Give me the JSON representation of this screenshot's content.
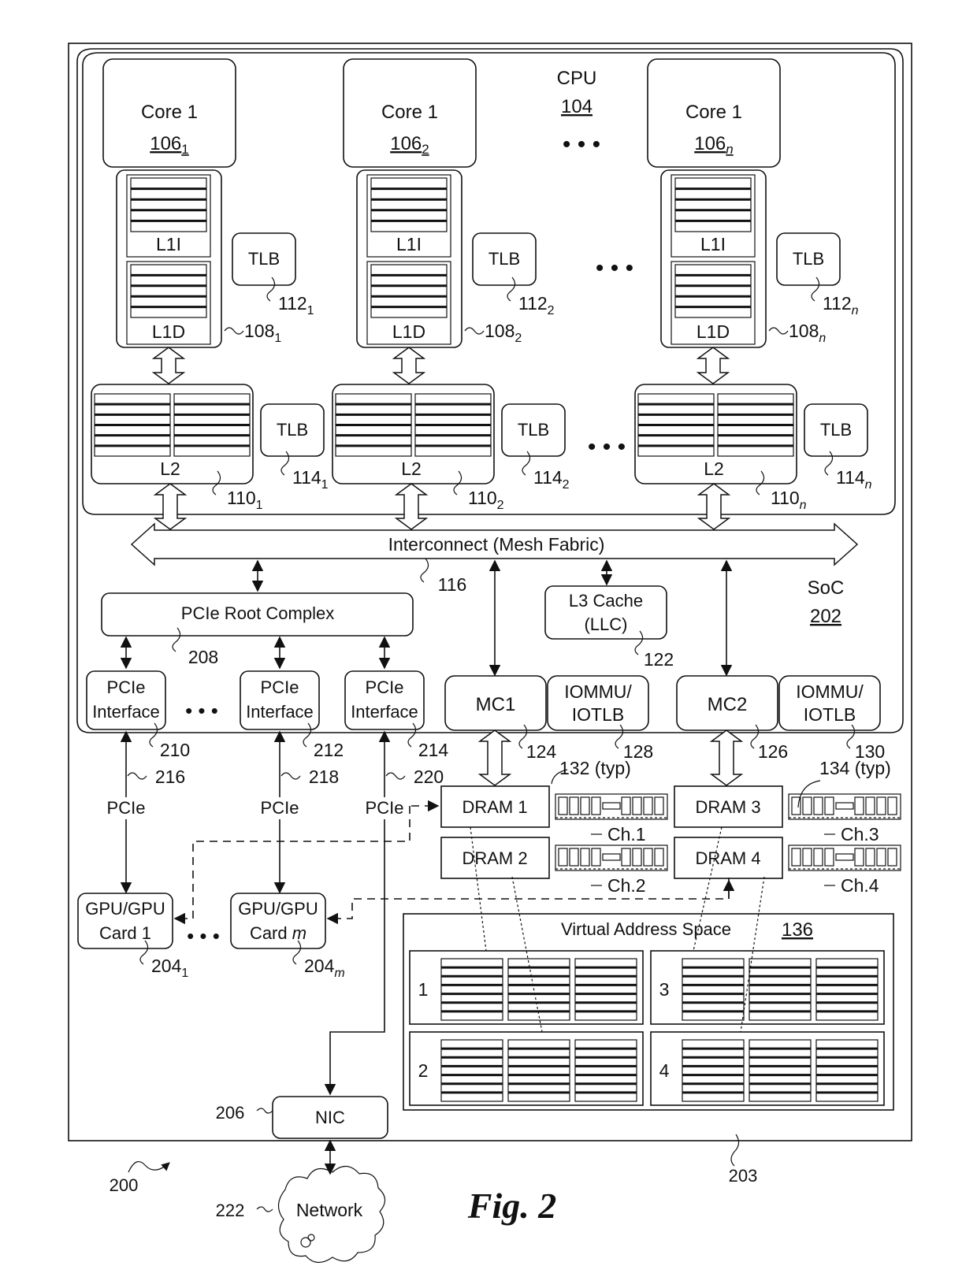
{
  "figure": {
    "caption": "Fig. 2",
    "system_ref": "200",
    "board_ref": "203"
  },
  "cpu": {
    "label": "CPU",
    "ref": "104",
    "ellipsis": "• • •"
  },
  "soc": {
    "label": "SoC",
    "ref": "202"
  },
  "cores": [
    {
      "label": "Core 1",
      "ref": "106",
      "sub": "1",
      "l1i": "L1I",
      "l1d": "L1D",
      "l1_ref": "108",
      "l1_sub": "1",
      "tlb1": "TLB",
      "tlb1_ref": "112",
      "tlb1_sub": "1",
      "l2": "L2",
      "l2_ref": "110",
      "l2_sub": "1",
      "tlb2": "TLB",
      "tlb2_ref": "114",
      "tlb2_sub": "1"
    },
    {
      "label": "Core 1",
      "ref": "106",
      "sub": "2",
      "l1i": "L1I",
      "l1d": "L1D",
      "l1_ref": "108",
      "l1_sub": "2",
      "tlb1": "TLB",
      "tlb1_ref": "112",
      "tlb1_sub": "2",
      "l2": "L2",
      "l2_ref": "110",
      "l2_sub": "2",
      "tlb2": "TLB",
      "tlb2_ref": "114",
      "tlb2_sub": "2"
    },
    {
      "label": "Core 1",
      "ref": "106",
      "sub": "n",
      "l1i": "L1I",
      "l1d": "L1D",
      "l1_ref": "108",
      "l1_sub": "n",
      "tlb1": "TLB",
      "tlb1_ref": "112",
      "tlb1_sub": "n",
      "l2": "L2",
      "l2_ref": "110",
      "l2_sub": "n",
      "tlb2": "TLB",
      "tlb2_ref": "114",
      "tlb2_sub": "n"
    }
  ],
  "interconnect": {
    "label": "Interconnect (Mesh Fabric)",
    "ref": "116"
  },
  "l3": {
    "line1": "L3 Cache",
    "line2": "(LLC)",
    "ref": "122"
  },
  "pcie_root": {
    "label": "PCIe Root Complex",
    "ref": "208"
  },
  "pcie_interfaces": [
    {
      "line1": "PCIe",
      "line2": "Interface",
      "ref": "210",
      "link_ref": "216",
      "link_label": "PCIe"
    },
    {
      "line1": "PCIe",
      "line2": "Interface",
      "ref": "212",
      "link_ref": "218",
      "link_label": "PCIe"
    },
    {
      "line1": "PCIe",
      "line2": "Interface",
      "ref": "214",
      "link_ref": "220",
      "link_label": "PCIe"
    }
  ],
  "memory_controllers": [
    {
      "label": "MC1",
      "ref": "124",
      "iommu1": "IOMMU/",
      "iommu2": "IOTLB",
      "iommu_ref": "128"
    },
    {
      "label": "MC2",
      "ref": "126",
      "iommu1": "IOMMU/",
      "iommu2": "IOTLB",
      "iommu_ref": "130"
    }
  ],
  "drams": [
    {
      "label": "DRAM 1",
      "channel": "Ch.1"
    },
    {
      "label": "DRAM 2",
      "channel": "Ch.2"
    },
    {
      "label": "DRAM 3",
      "channel": "Ch.3"
    },
    {
      "label": "DRAM 4",
      "channel": "Ch.4"
    }
  ],
  "dram_refs": {
    "dram_typ": "132 (typ)",
    "dimm_typ": "134 (typ)"
  },
  "gpus": [
    {
      "line1": "GPU/GPU",
      "line2": "Card 1",
      "ref": "204",
      "sub": "1"
    },
    {
      "line1": "GPU/GPU",
      "line2": "Card ",
      "line2_var": "m",
      "ref": "204",
      "sub": "m"
    }
  ],
  "vas": {
    "label": "Virtual Address Space",
    "ref": "136",
    "regions": [
      "1",
      "2",
      "3",
      "4"
    ]
  },
  "nic": {
    "label": "NIC",
    "ref": "206"
  },
  "network": {
    "label": "Network",
    "ref": "222"
  }
}
